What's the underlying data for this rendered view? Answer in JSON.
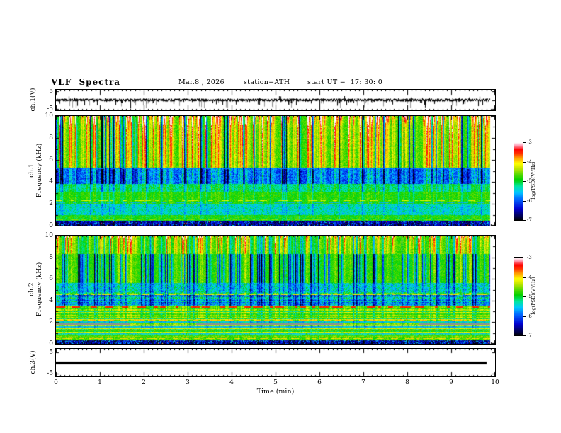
{
  "header": {
    "title": "VLF Spectra",
    "date": "Mar.8 , 2026",
    "station": "station=ATH",
    "start_ut": "start UT =  17: 30: 0"
  },
  "axes": {
    "time_label": "Time (min)",
    "time_ticks": [
      "0",
      "1",
      "2",
      "3",
      "4",
      "5",
      "6",
      "7",
      "8",
      "9",
      "10"
    ],
    "wave1": {
      "channel": "ch.1(V)",
      "y_ticks": [
        "5",
        "-5"
      ]
    },
    "spec1": {
      "channel": "ch.1",
      "freq_label": "Frequency (kHz)",
      "y_ticks": [
        "10",
        "8",
        "6",
        "4",
        "2",
        "0"
      ]
    },
    "spec2": {
      "channel": "ch.2",
      "freq_label": "Frequency (kHz)",
      "y_ticks": [
        "10",
        "8",
        "6",
        "4",
        "2",
        "0"
      ]
    },
    "wave3": {
      "channel": "ch.3(V)",
      "y_ticks": [
        "5",
        "-5"
      ]
    }
  },
  "colorbars": [
    {
      "label": "log(PSD)(V²/Hz)",
      "ticks": [
        "-3",
        "-4",
        "-5",
        "-6",
        "-7"
      ]
    },
    {
      "label": "log(PSD)(V²/Hz)",
      "ticks": [
        "-3",
        "-4",
        "-5",
        "-6",
        "-7"
      ]
    }
  ],
  "chart_data": [
    {
      "id": "wave1",
      "type": "line",
      "channel": "ch.1(V)",
      "xlim": [
        0,
        10
      ],
      "ylim": [
        -6,
        6
      ],
      "y_tick_values": [
        5,
        0,
        -5
      ],
      "line_color": "#000000",
      "ghost_color": "#9a9a9a",
      "signal": {
        "baseline": 0,
        "noise_amp": 0.6,
        "down_spike_rate": 0.1,
        "down_spike_max": 4.8,
        "up_spike_rate": 0.05,
        "up_spike_max": 2.8,
        "ghost_lines": 55,
        "data_end": 9.88
      },
      "seed": 41
    },
    {
      "id": "spec1",
      "type": "spectrogram",
      "channel": "ch.1",
      "xlim": [
        0,
        10
      ],
      "flim": [
        0,
        10
      ],
      "clim": [
        -7,
        -3
      ],
      "data_end": 9.88,
      "seed": 12345,
      "colormap": [
        {
          "at": 0.0,
          "color": "#000000"
        },
        {
          "at": 0.05,
          "color": "#00004a"
        },
        {
          "at": 0.15,
          "color": "#0000d0"
        },
        {
          "at": 0.27,
          "color": "#0064ff"
        },
        {
          "at": 0.36,
          "color": "#00c8ff"
        },
        {
          "at": 0.44,
          "color": "#00e6a0"
        },
        {
          "at": 0.52,
          "color": "#00d200"
        },
        {
          "at": 0.6,
          "color": "#64dc00"
        },
        {
          "at": 0.67,
          "color": "#c8e600"
        },
        {
          "at": 0.73,
          "color": "#ffff00"
        },
        {
          "at": 0.8,
          "color": "#ffa000"
        },
        {
          "at": 0.86,
          "color": "#ff3200"
        },
        {
          "at": 0.91,
          "color": "#ff0000"
        },
        {
          "at": 0.96,
          "color": "#ff9bb4"
        },
        {
          "at": 1.0,
          "color": "#ffffff"
        }
      ],
      "streaks": {
        "bright_density": 0.32,
        "dark_density": 0.07
      },
      "bands": [
        {
          "f0": 5.3,
          "f1": 10,
          "base": 0.57,
          "noise": 0.06,
          "bright": 1.0,
          "dark": 1.0,
          "topfade": 0.75
        },
        {
          "f0": 3.8,
          "f1": 5.3,
          "base": 0.24,
          "noise": 0.1,
          "bright": 0.5,
          "dark": 0.55
        },
        {
          "f0": 3.1,
          "f1": 3.8,
          "base": 0.43,
          "noise": 0.08,
          "bright": 0.3,
          "dark": 0.3
        },
        {
          "f0": 2.0,
          "f1": 3.1,
          "base": 0.53,
          "noise": 0.06,
          "bright": 0.15,
          "dark": 0.2
        },
        {
          "f0": 0.95,
          "f1": 2.0,
          "base": 0.4,
          "noise": 0.09,
          "bright": 0.1,
          "dark": 0.15
        },
        {
          "f0": 0.45,
          "f1": 0.95,
          "base": 0.52,
          "noise": 0.07,
          "bright": 0.08,
          "dark": 0.1
        },
        {
          "f0": 0.0,
          "f1": 0.45,
          "base": 0.08,
          "noise": 0.1,
          "bright": 0.3,
          "dark": 0.05,
          "speckle_cyan": 0.08,
          "speckle_warm": 0.012
        }
      ],
      "hlines": [
        {
          "f": 5.25,
          "v": 0.3,
          "px": 1,
          "dash": 0.3
        },
        {
          "f": 2.3,
          "v": 0.7,
          "px": 1,
          "dash": 0.5
        },
        {
          "f": 2.16,
          "v": 0.34,
          "px": 1,
          "dash": 0.5
        },
        {
          "f": 0.82,
          "v": 0.64,
          "px": 1,
          "dash": 0.35
        },
        {
          "f": 0.6,
          "v": 0.62,
          "px": 1,
          "dash": 0.35
        }
      ]
    },
    {
      "id": "spec2",
      "type": "spectrogram",
      "channel": "ch.2",
      "xlim": [
        0,
        10
      ],
      "flim": [
        0,
        10
      ],
      "clim": [
        -7,
        -3
      ],
      "data_end": 9.88,
      "seed": 777,
      "colormap": [
        {
          "at": 0.0,
          "color": "#000000"
        },
        {
          "at": 0.05,
          "color": "#00004a"
        },
        {
          "at": 0.15,
          "color": "#0000d0"
        },
        {
          "at": 0.27,
          "color": "#0064ff"
        },
        {
          "at": 0.36,
          "color": "#00c8ff"
        },
        {
          "at": 0.44,
          "color": "#00e6a0"
        },
        {
          "at": 0.52,
          "color": "#00d200"
        },
        {
          "at": 0.6,
          "color": "#64dc00"
        },
        {
          "at": 0.67,
          "color": "#c8e600"
        },
        {
          "at": 0.73,
          "color": "#ffff00"
        },
        {
          "at": 0.8,
          "color": "#ffa000"
        },
        {
          "at": 0.86,
          "color": "#ff3200"
        },
        {
          "at": 0.91,
          "color": "#ff0000"
        },
        {
          "at": 0.96,
          "color": "#ff9bb4"
        },
        {
          "at": 1.0,
          "color": "#ffffff"
        }
      ],
      "streaks": {
        "bright_density": 0.2,
        "dark_density": 0.2
      },
      "bands": [
        {
          "f0": 8.3,
          "f1": 10,
          "base": 0.57,
          "noise": 0.06,
          "bright": 1.0,
          "dark": 0.4,
          "topfade": 0.8
        },
        {
          "f0": 5.6,
          "f1": 8.3,
          "base": 0.55,
          "noise": 0.06,
          "bright": 0.3,
          "dark": 1.0
        },
        {
          "f0": 4.8,
          "f1": 5.6,
          "base": 0.4,
          "noise": 0.11,
          "bright": 0.2,
          "dark": 0.4
        },
        {
          "f0": 3.55,
          "f1": 4.8,
          "base": 0.41,
          "noise": 0.12,
          "bright": 0.2,
          "dark": 0.45,
          "hstripe": 0.05
        },
        {
          "f0": 2.4,
          "f1": 3.55,
          "base": 0.58,
          "noise": 0.06,
          "bright": 0.2,
          "dark": 0.2,
          "hstripe": 0.04
        },
        {
          "f0": 1.55,
          "f1": 2.4,
          "base": 0.51,
          "noise": 0.07,
          "bright": 0.1,
          "dark": 0.15,
          "hstripe": 0.07
        },
        {
          "f0": 0.65,
          "f1": 1.55,
          "base": 0.54,
          "noise": 0.06,
          "bright": 0.08,
          "dark": 0.1,
          "hstripe": 0.07
        },
        {
          "f0": 0.35,
          "f1": 0.65,
          "base": 0.58,
          "noise": 0.07,
          "bright": 0.06,
          "dark": 0.08
        },
        {
          "f0": 0.0,
          "f1": 0.35,
          "base": 0.1,
          "noise": 0.12,
          "bright": 0.3,
          "dark": 0.05,
          "speckle_cyan": 0.1,
          "speckle_warm": 0.004
        }
      ],
      "hlines": [
        {
          "f": 5.55,
          "v": 0.32,
          "px": 1,
          "dash": 0.25
        },
        {
          "f": 4.55,
          "v": 0.74,
          "px": 1,
          "dash": 0.2
        },
        {
          "f": 3.4,
          "v": 0.88,
          "px": 2,
          "dash": 0.5
        },
        {
          "f": 2.2,
          "v": 0.78,
          "px": 1,
          "dash": 0.25
        },
        {
          "f": 1.8,
          "color": "#8e9296",
          "px": 3,
          "dash": 0.5,
          "seg": true
        },
        {
          "f": 1.5,
          "v": 0.72,
          "px": 1,
          "dash": 0.2
        },
        {
          "f": 1.0,
          "v": 0.35,
          "px": 1,
          "dash": 0.4
        },
        {
          "f": 0.5,
          "v": 0.76,
          "px": 1,
          "dash": 0.3
        }
      ]
    },
    {
      "id": "wave3",
      "type": "flatline",
      "channel": "ch.3(V)",
      "xlim": [
        0,
        10
      ],
      "ylim": [
        -6.5,
        6.5
      ],
      "y_tick_values": [
        5,
        -5
      ],
      "value": 0,
      "x_start": 0,
      "x_end": 9.8,
      "thickness_px": 4,
      "color": "#000000",
      "seed": 9
    }
  ]
}
